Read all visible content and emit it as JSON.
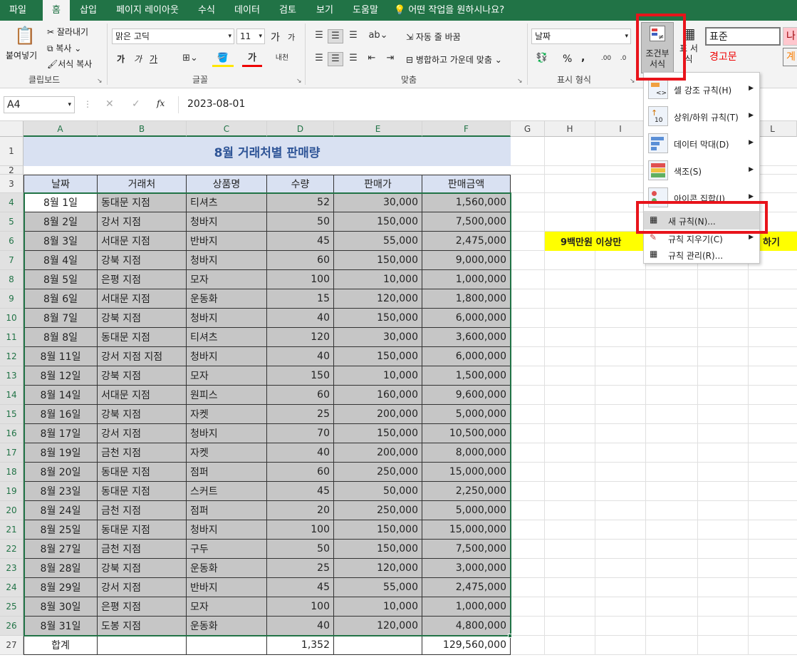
{
  "tabs": [
    "파일",
    "홈",
    "삽입",
    "페이지 레이아웃",
    "수식",
    "데이터",
    "검토",
    "보기",
    "도움말"
  ],
  "tell_me": "어떤 작업을 원하시나요?",
  "ribbon": {
    "paste": "붙여넣기",
    "cut": "잘라내기",
    "copy": "복사",
    "format_painter": "서식 복사",
    "clipboard": "클립보드",
    "font_name": "맑은 고딕",
    "font_size": "11",
    "font_group": "글꼴",
    "bold": "가",
    "italic": "가",
    "underline": "가",
    "grow": "가",
    "shrink": "가",
    "wrap": "자동 줄 바꿈",
    "merge": "병합하고 가운데 맞춤",
    "align_group": "맞춤",
    "number_format": "날짜",
    "number_group": "표시 형식",
    "percent": "%",
    "comma": ",",
    "cond_format": "조건부 서식",
    "table_format": "표 서식",
    "style_normal": "표준",
    "style_warning": "경고문",
    "style_bad": "나",
    "style_calc": "계"
  },
  "formula_bar": {
    "name_box": "A4",
    "fx": "fx",
    "value": "2023-08-01"
  },
  "columns": [
    "A",
    "B",
    "C",
    "D",
    "E",
    "F",
    "G",
    "H",
    "I",
    "J",
    "K",
    "L"
  ],
  "rows": [
    "1",
    "2",
    "3",
    "4",
    "5",
    "6",
    "7",
    "8",
    "9",
    "10",
    "11",
    "12",
    "13",
    "14",
    "15",
    "16",
    "17",
    "18",
    "19",
    "20",
    "21",
    "22",
    "23",
    "24",
    "25",
    "26",
    "27"
  ],
  "sheet": {
    "title": "8월 거래처별 판매량",
    "headers": [
      "날짜",
      "거래처",
      "상품명",
      "수량",
      "판매가",
      "판매금액"
    ],
    "data": [
      [
        "8월 1일",
        "동대문 지점",
        "티셔츠",
        "52",
        "30,000",
        "1,560,000"
      ],
      [
        "8월 2일",
        "강서 지점",
        "청바지",
        "50",
        "150,000",
        "7,500,000"
      ],
      [
        "8월 3일",
        "서대문 지점",
        "반바지",
        "45",
        "55,000",
        "2,475,000"
      ],
      [
        "8월 4일",
        "강북 지점",
        "청바지",
        "60",
        "150,000",
        "9,000,000"
      ],
      [
        "8월 5일",
        "은평 지점",
        "모자",
        "100",
        "10,000",
        "1,000,000"
      ],
      [
        "8월 6일",
        "서대문 지점",
        "운동화",
        "15",
        "120,000",
        "1,800,000"
      ],
      [
        "8월 7일",
        "강북 지점",
        "청바지",
        "40",
        "150,000",
        "6,000,000"
      ],
      [
        "8월 8일",
        "동대문 지점",
        "티셔츠",
        "120",
        "30,000",
        "3,600,000"
      ],
      [
        "8월 11일",
        "강서 지점 지점",
        "청바지",
        "40",
        "150,000",
        "6,000,000"
      ],
      [
        "8월 12일",
        "강북 지점",
        "모자",
        "150",
        "10,000",
        "1,500,000"
      ],
      [
        "8월 14일",
        "서대문 지점",
        "원피스",
        "60",
        "160,000",
        "9,600,000"
      ],
      [
        "8월 16일",
        "강북 지점",
        "자켓",
        "25",
        "200,000",
        "5,000,000"
      ],
      [
        "8월 17일",
        "강서 지점",
        "청바지",
        "70",
        "150,000",
        "10,500,000"
      ],
      [
        "8월 19일",
        "금천 지점",
        "자켓",
        "40",
        "200,000",
        "8,000,000"
      ],
      [
        "8월 20일",
        "동대문 지점",
        "점퍼",
        "60",
        "250,000",
        "15,000,000"
      ],
      [
        "8월 23일",
        "동대문 지점",
        "스커트",
        "45",
        "50,000",
        "2,250,000"
      ],
      [
        "8월 24일",
        "금천 지점",
        "점퍼",
        "20",
        "250,000",
        "5,000,000"
      ],
      [
        "8월 25일",
        "동대문 지점",
        "청바지",
        "100",
        "150,000",
        "15,000,000"
      ],
      [
        "8월 27일",
        "금천 지점",
        "구두",
        "50",
        "150,000",
        "7,500,000"
      ],
      [
        "8월 28일",
        "강북 지점",
        "운동화",
        "25",
        "120,000",
        "3,000,000"
      ],
      [
        "8월 29일",
        "강서 지점",
        "반바지",
        "45",
        "55,000",
        "2,475,000"
      ],
      [
        "8월 30일",
        "은평 지점",
        "모자",
        "100",
        "10,000",
        "1,000,000"
      ],
      [
        "8월 31일",
        "도봉 지점",
        "운동화",
        "40",
        "120,000",
        "4,800,000"
      ]
    ],
    "total": [
      "합계",
      "",
      "",
      "1,352",
      "",
      "129,560,000"
    ],
    "note_left": "9백만원 이상만 ",
    "note_right": "하기"
  },
  "menu": [
    {
      "label": "셀 강조 규칙(H)",
      "sub": true
    },
    {
      "label": "상위/하위 규칙(T)",
      "sub": true
    },
    {
      "label": "데이터 막대(D)",
      "sub": true
    },
    {
      "label": "색조(S)",
      "sub": true
    },
    {
      "label": "아이콘 집합(I)",
      "sub": true
    },
    {
      "label": "새 규칙(N)...",
      "sub": false
    },
    {
      "label": "규칙 지우기(C)",
      "sub": true
    },
    {
      "label": "규칙 관리(R)...",
      "sub": false
    }
  ]
}
